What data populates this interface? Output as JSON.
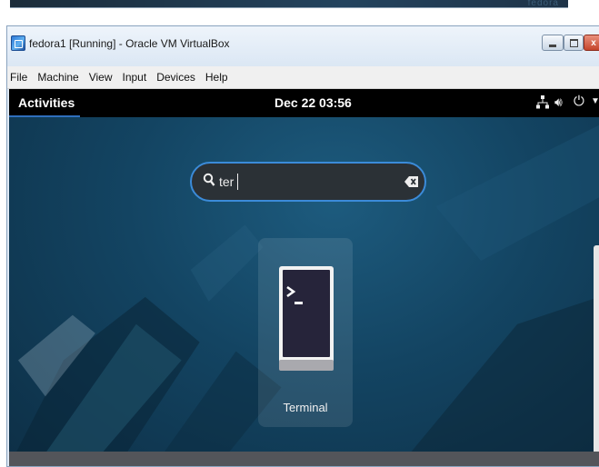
{
  "host": {
    "desktop_strip_text": "fedora"
  },
  "window": {
    "title": "fedora1 [Running] - Oracle VM VirtualBox",
    "controls": [
      "minimize",
      "maximize",
      "close"
    ],
    "close_glyph": "x"
  },
  "menubar": {
    "items": [
      "File",
      "Machine",
      "View",
      "Input",
      "Devices",
      "Help"
    ]
  },
  "gnome": {
    "activities_label": "Activities",
    "clock": "Dec 22 03:56",
    "tray_icons": [
      "network-icon",
      "volume-icon",
      "power-icon",
      "menu-arrow-icon"
    ],
    "search": {
      "value": "ter",
      "icon": "search-icon",
      "clear_icon": "clear-icon"
    },
    "results": [
      {
        "label": "Terminal",
        "icon": "terminal-icon"
      }
    ]
  },
  "colors": {
    "accent": "#3b8bd9",
    "topbar": "#000000",
    "search_bg": "#2b3136",
    "close_button": "#c5452b"
  }
}
